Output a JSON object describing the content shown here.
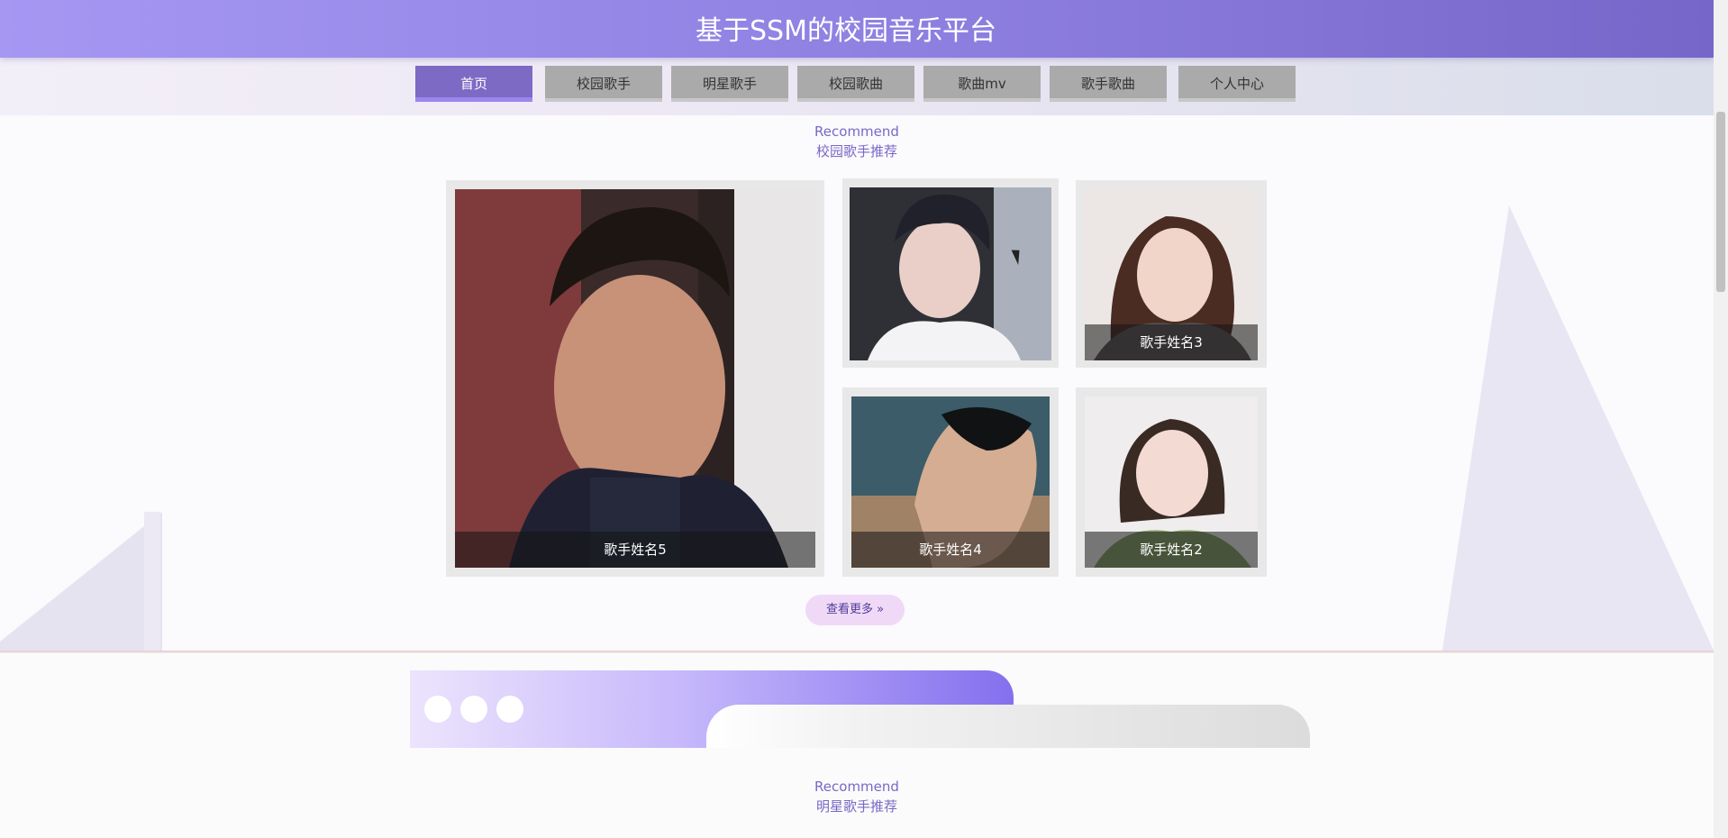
{
  "header": {
    "title": "基于SSM的校园音乐平台"
  },
  "nav": {
    "items": [
      {
        "label": "首页",
        "active": true
      },
      {
        "label": "校园歌手",
        "active": false
      },
      {
        "label": "明星歌手",
        "active": false
      },
      {
        "label": "校园歌曲",
        "active": false
      },
      {
        "label": "歌曲mv",
        "active": false
      },
      {
        "label": "歌手歌曲",
        "active": false
      },
      {
        "label": "个人中心",
        "active": false
      }
    ]
  },
  "section_campus": {
    "eyebrow": "Recommend",
    "title": "校园歌手推荐",
    "cards": [
      {
        "caption": "歌手姓名5"
      },
      {
        "caption": ""
      },
      {
        "caption": "歌手姓名3"
      },
      {
        "caption": "歌手姓名4"
      },
      {
        "caption": "歌手姓名2"
      }
    ],
    "more_label": "查看更多 »"
  },
  "section_star": {
    "eyebrow": "Recommend",
    "title": "明星歌手推荐"
  },
  "colors": {
    "header_start": "#a597f2",
    "header_end": "#7766c9",
    "active_nav": "#7c6ac4",
    "inactive_nav": "#aaaaaa",
    "accent_text": "#7a68c6"
  }
}
